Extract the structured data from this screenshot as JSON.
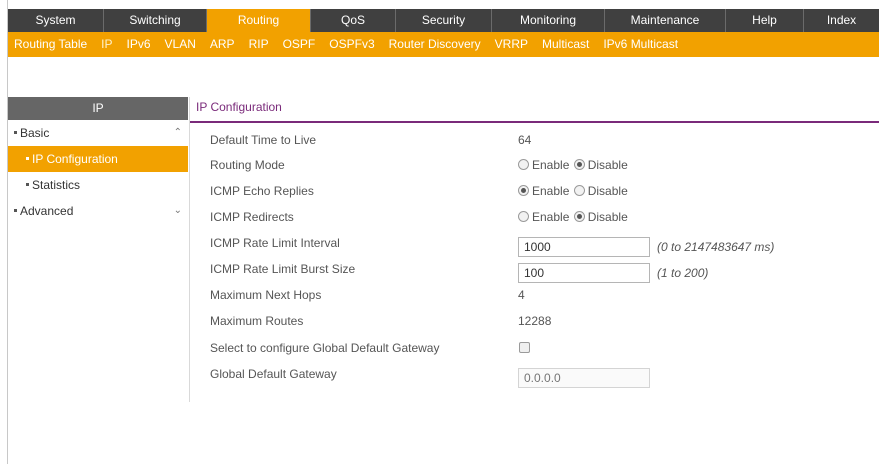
{
  "nav": {
    "tabs": [
      {
        "label": "System",
        "active": false
      },
      {
        "label": "Switching",
        "active": false
      },
      {
        "label": "Routing",
        "active": true
      },
      {
        "label": "QoS",
        "active": false
      },
      {
        "label": "Security",
        "active": false
      },
      {
        "label": "Monitoring",
        "active": false
      },
      {
        "label": "Maintenance",
        "active": false
      },
      {
        "label": "Help",
        "active": false
      },
      {
        "label": "Index",
        "active": false
      }
    ],
    "subtabs": [
      {
        "label": "Routing Table",
        "active": false
      },
      {
        "label": "IP",
        "active": true
      },
      {
        "label": "IPv6",
        "active": false
      },
      {
        "label": "VLAN",
        "active": false
      },
      {
        "label": "ARP",
        "active": false
      },
      {
        "label": "RIP",
        "active": false
      },
      {
        "label": "OSPF",
        "active": false
      },
      {
        "label": "OSPFv3",
        "active": false
      },
      {
        "label": "Router Discovery",
        "active": false
      },
      {
        "label": "VRRP",
        "active": false
      },
      {
        "label": "Multicast",
        "active": false
      },
      {
        "label": "IPv6 Multicast",
        "active": false
      }
    ]
  },
  "sidebar": {
    "title": "IP",
    "items": [
      {
        "label": "Basic",
        "level": 1,
        "active": false,
        "chevron": "chevron-up"
      },
      {
        "label": "IP Configuration",
        "level": 2,
        "active": true
      },
      {
        "label": "Statistics",
        "level": 2,
        "active": false
      },
      {
        "label": "Advanced",
        "level": 1,
        "active": false,
        "chevron": "chevron-down"
      }
    ]
  },
  "content": {
    "title": "IP Configuration",
    "default_ttl": {
      "label": "Default Time to Live",
      "value": "64"
    },
    "routing_mode": {
      "label": "Routing Mode",
      "options": [
        "Enable",
        "Disable"
      ],
      "selected": "Disable"
    },
    "icmp_echo": {
      "label": "ICMP Echo Replies",
      "options": [
        "Enable",
        "Disable"
      ],
      "selected": "Enable"
    },
    "icmp_redirects": {
      "label": "ICMP Redirects",
      "options": [
        "Enable",
        "Disable"
      ],
      "selected": "Disable"
    },
    "icmp_rate_interval": {
      "label": "ICMP Rate Limit Interval",
      "value": "1000",
      "hint": "(0 to 2147483647 ms)"
    },
    "icmp_rate_burst": {
      "label": "ICMP Rate Limit Burst Size",
      "value": "100",
      "hint": "(1 to 200)"
    },
    "max_next_hops": {
      "label": "Maximum Next Hops",
      "value": "4"
    },
    "max_routes": {
      "label": "Maximum Routes",
      "value": "12288"
    },
    "global_gw_select": {
      "label": "Select to configure Global Default Gateway",
      "checked": false
    },
    "global_gw": {
      "label": "Global Default Gateway",
      "placeholder": "0.0.0.0"
    }
  },
  "colors": {
    "accent": "#f2a100",
    "nav_bg": "#404040",
    "title_purple": "#7a2a7a",
    "sidebar_header": "#666666"
  }
}
